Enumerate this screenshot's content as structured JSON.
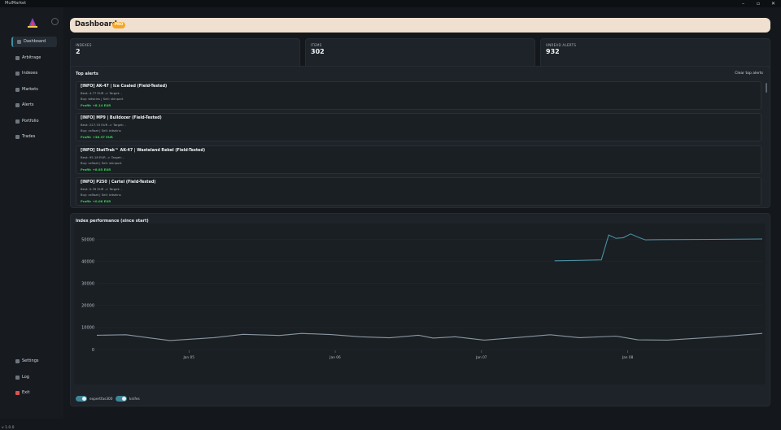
{
  "window": {
    "title": "MulMarket",
    "minimize": "–",
    "maximize": "▫",
    "close": "✕"
  },
  "sidebar": {
    "logo": "logo-icon",
    "items": [
      {
        "label": "Dashboard",
        "icon": "dashboard-icon",
        "active": true
      },
      {
        "label": "Arbitrage",
        "icon": "arbitrage-icon"
      },
      {
        "label": "Indexes",
        "icon": "indexes-icon"
      },
      {
        "label": "Markets",
        "icon": "markets-icon"
      },
      {
        "label": "Alerts",
        "icon": "alerts-icon"
      },
      {
        "label": "Portfolio",
        "icon": "portfolio-icon"
      },
      {
        "label": "Trades",
        "icon": "trades-icon"
      }
    ],
    "bottom_items": [
      {
        "label": "Settings",
        "icon": "settings-icon"
      },
      {
        "label": "Log",
        "icon": "log-icon"
      },
      {
        "label": "Exit",
        "icon": "exit-icon"
      }
    ],
    "version": "v 1.0.0"
  },
  "header": {
    "title": "Dashboard",
    "badge": "PRO"
  },
  "stats": [
    {
      "label": "INDEXES",
      "value": "2"
    },
    {
      "label": "ITEMS",
      "value": "302"
    },
    {
      "label": "UNREAD ALERTS",
      "value": "932"
    }
  ],
  "alerts_panel": {
    "title": "Top alerts",
    "clear_label": "Clear top alerts",
    "alerts": [
      {
        "title": "[INFO] AK-47 | Ice Coaled (Field-Tested)",
        "line1": "Best: 4.77 EUR  ->  Target: -",
        "line2": "Buy: bitskins  |  Sell: skinport",
        "profit": "Profit: +8.14 EUR"
      },
      {
        "title": "[INFO] MP9 | Bulldozer (Field-Tested)",
        "line1": "Best: 227.33 EUR  ->  Target: -",
        "line2": "Buy: csfloat  |  Sell: bitskins",
        "profit": "Profit: +36.37 EUR"
      },
      {
        "title": "[INFO] StatTrak™ AK-47 | Wasteland Rebel (Field-Tested)",
        "line1": "Best: 95.18 EUR  ->  Target: -",
        "line2": "Buy: csfloat  |  Sell: skinport",
        "profit": "Profit: +8.85 EUR"
      },
      {
        "title": "[INFO] P250 | Cartel (Field-Tested)",
        "line1": "Best: 0.39 EUR  ->  Target: -",
        "line2": "Buy: csfloat  |  Sell: bitskins",
        "profit": "Profit: +0.06 EUR"
      }
    ]
  },
  "chart_panel": {
    "title": "Index performance (since start)",
    "legend": [
      {
        "label": "expertfas300",
        "enabled": true,
        "color": "#4a8fa0"
      },
      {
        "label": "knifes",
        "enabled": true,
        "color": "#8a96a0"
      }
    ]
  },
  "chart_data": {
    "type": "line",
    "title": "",
    "xlabel": "",
    "ylabel": "",
    "ylim": [
      0,
      55000
    ],
    "yticks": [
      0,
      10000,
      20000,
      30000,
      40000,
      50000
    ],
    "xtick_labels": [
      "Jan 05",
      "Jan 06",
      "Jan 07",
      "Jan 08"
    ],
    "xlim": [
      0,
      4.55
    ],
    "xtick_positions": [
      0.63,
      1.63,
      2.63,
      3.63
    ],
    "grid": true,
    "legend_position": "bottom-left",
    "series": [
      {
        "name": "expertfas300",
        "color": "#4a8fa0",
        "x": [
          3.13,
          3.3,
          3.45,
          3.5,
          3.55,
          3.6,
          3.65,
          3.7,
          3.75,
          3.85,
          4.2,
          4.55
        ],
        "y": [
          40300,
          40500,
          40700,
          52000,
          50500,
          50800,
          52500,
          51000,
          49800,
          49900,
          50000,
          50200
        ]
      },
      {
        "name": "knifes",
        "color": "#8a96a0",
        "x": [
          0.0,
          0.2,
          0.35,
          0.5,
          0.8,
          1.0,
          1.25,
          1.4,
          1.6,
          1.8,
          2.0,
          2.2,
          2.3,
          2.45,
          2.65,
          2.85,
          3.1,
          3.3,
          3.55,
          3.7,
          3.9,
          4.2,
          4.55
        ],
        "y": [
          6500,
          6700,
          5400,
          4100,
          5400,
          6900,
          6400,
          7300,
          6800,
          5800,
          5300,
          6500,
          5200,
          5800,
          4300,
          5300,
          6700,
          5400,
          6100,
          4400,
          4300,
          5500,
          7300
        ]
      }
    ]
  }
}
